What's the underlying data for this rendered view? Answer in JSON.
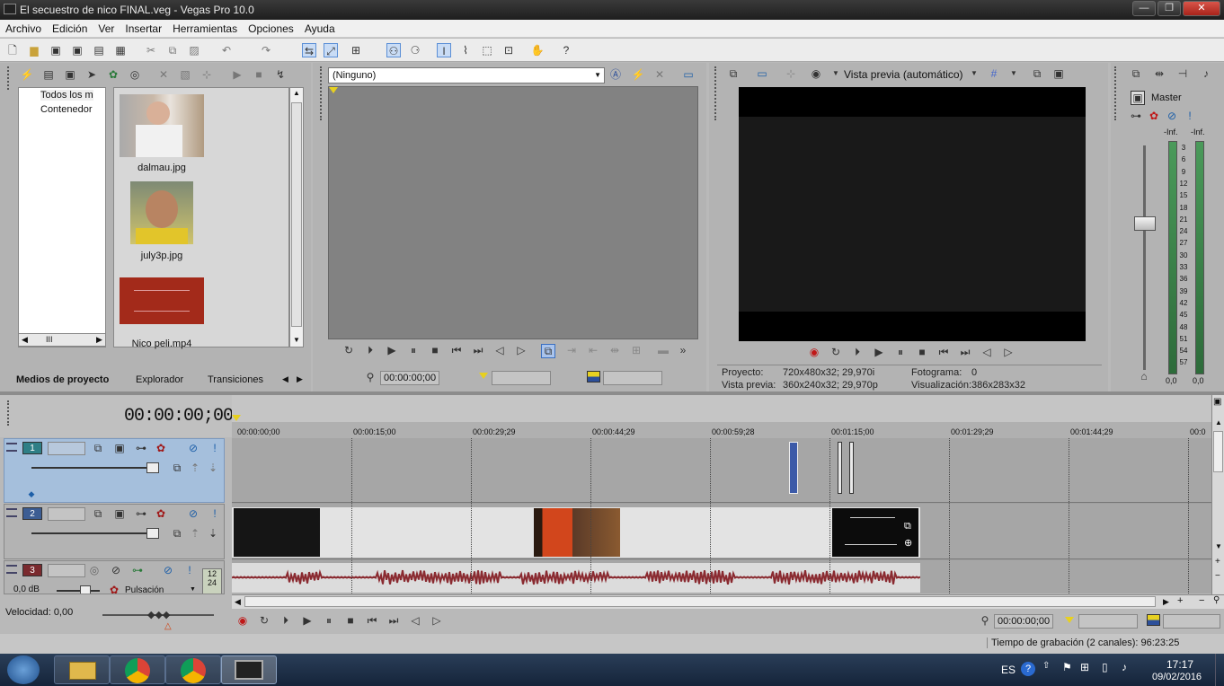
{
  "window": {
    "title": "El secuestro de nico FINAL.veg - Vegas Pro 10.0"
  },
  "menu": [
    "Archivo",
    "Edición",
    "Ver",
    "Insertar",
    "Herramientas",
    "Opciones",
    "Ayuda"
  ],
  "media_panel": {
    "tree_items": [
      "Todos los m",
      "Contenedor"
    ],
    "files": [
      {
        "name": "dalmau.jpg"
      },
      {
        "name": "july3p.jpg"
      },
      {
        "name": "Nico peli.mp4"
      }
    ],
    "tabs": [
      "Medios de proyecto",
      "Explorador",
      "Transiciones"
    ],
    "scroll_label": "III"
  },
  "trimmer": {
    "dropdown_value": "(Ninguno)",
    "timecode": "00:00:00;00"
  },
  "preview": {
    "mode_label": "Vista previa (automático)",
    "info": {
      "proyecto_label": "Proyecto:",
      "proyecto_value": "720x480x32; 29,970i",
      "vista_label": "Vista previa:",
      "vista_value": "360x240x32; 29,970p",
      "fotograma_label": "Fotograma:",
      "fotograma_value": "0",
      "visualizacion_label": "Visualización:",
      "visualizacion_value": "386x283x32"
    }
  },
  "master": {
    "label": "Master",
    "inf_left": "-Inf.",
    "inf_right": "-Inf.",
    "scale": [
      "3",
      "6",
      "9",
      "12",
      "15",
      "18",
      "21",
      "24",
      "27",
      "30",
      "33",
      "36",
      "39",
      "42",
      "45",
      "48",
      "51",
      "54",
      "57"
    ],
    "bottom_left": "0,0",
    "bottom_right": "0,0"
  },
  "timeline": {
    "current_time": "00:00:00;00",
    "ruler_ticks": [
      "00:00:00;00",
      "00:00:15;00",
      "00:00:29;29",
      "00:00:44;29",
      "00:00:59;28",
      "00:01:15;00",
      "00:01:29;29",
      "00:01:44;29",
      "00:0"
    ],
    "tracks": [
      {
        "number": "1",
        "color": "#2f7f86"
      },
      {
        "number": "2",
        "color": "#3c5d93"
      },
      {
        "number": "3",
        "color": "#7a2a2e",
        "volume": "0,0 dB",
        "mode": "Pulsación",
        "side_badge": [
          "12",
          "24"
        ]
      }
    ]
  },
  "bottom": {
    "velocidad": "Velocidad: 0,00",
    "timecode": "00:00:00;00",
    "status": "Tiempo de grabación (2 canales): 96:23:25"
  },
  "taskbar": {
    "lang": "ES",
    "time": "17:17",
    "date": "09/02/2016"
  }
}
